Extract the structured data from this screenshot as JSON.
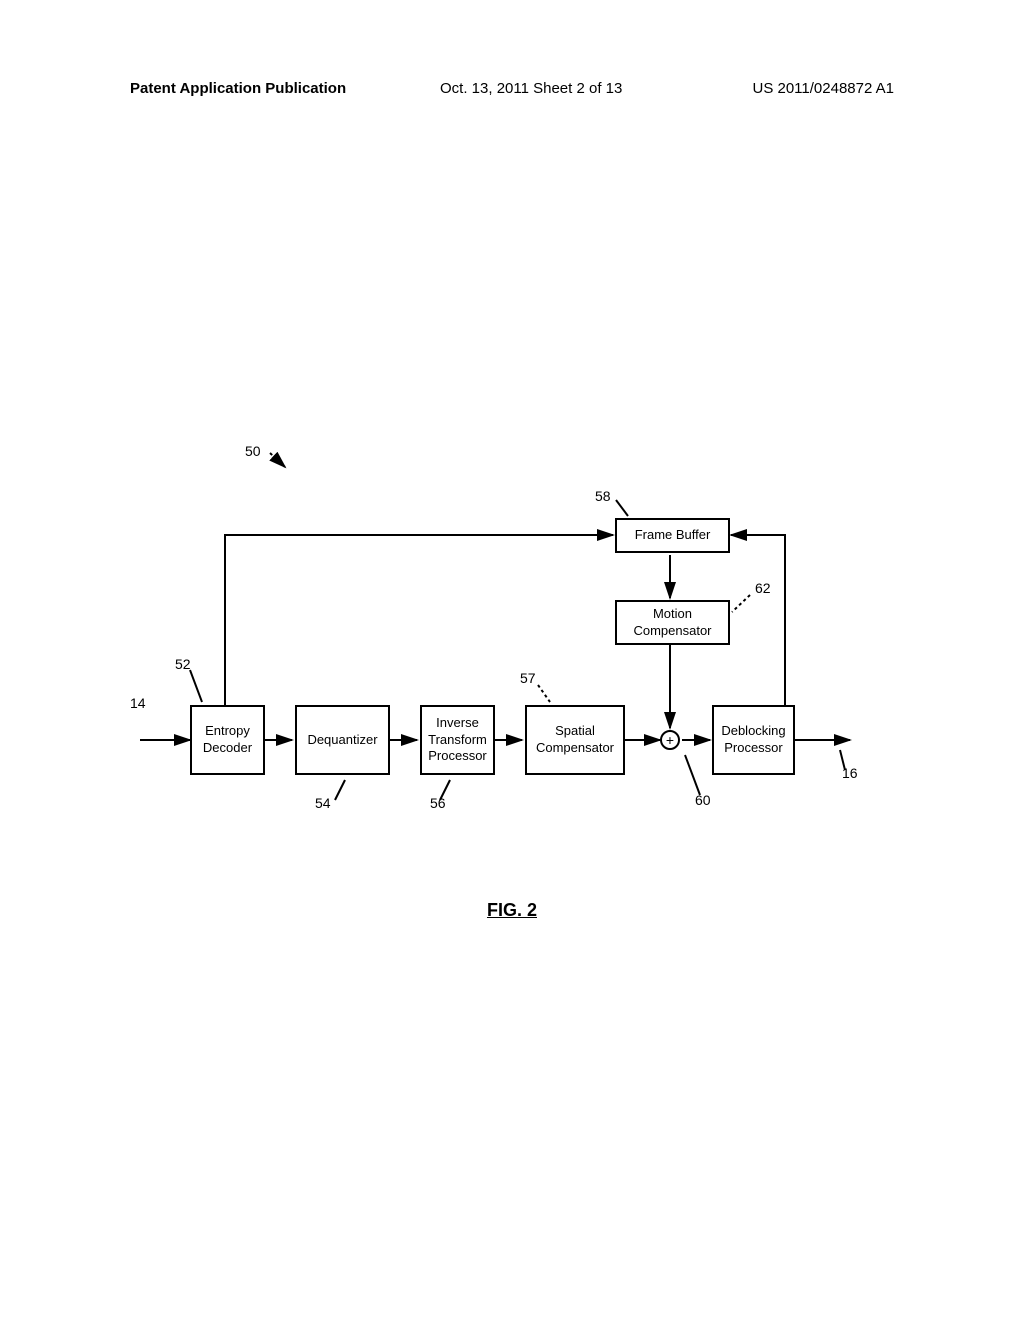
{
  "header": {
    "left": "Patent Application Publication",
    "center": "Oct. 13, 2011  Sheet 2 of 13",
    "right": "US 2011/0248872 A1"
  },
  "refs": {
    "r50": "50",
    "r58": "58",
    "r62": "62",
    "r52": "52",
    "r14": "14",
    "r57": "57",
    "r54": "54",
    "r56": "56",
    "r60": "60",
    "r16": "16"
  },
  "blocks": {
    "entropy_decoder": "Entropy\nDecoder",
    "dequantizer": "Dequantizer",
    "inverse_transform": "Inverse\nTransform\nProcessor",
    "spatial_compensator": "Spatial\nCompensator",
    "frame_buffer": "Frame Buffer",
    "motion_compensator": "Motion\nCompensator",
    "deblocking_processor": "Deblocking\nProcessor"
  },
  "figure_label": "FIG. 2",
  "chart_data": {
    "type": "diagram",
    "title": "FIG. 2",
    "description": "Block diagram of video decoder system 50",
    "nodes": [
      {
        "id": 52,
        "label": "Entropy Decoder"
      },
      {
        "id": 54,
        "label": "Dequantizer"
      },
      {
        "id": 56,
        "label": "Inverse Transform Processor"
      },
      {
        "id": 57,
        "label": "Spatial Compensator"
      },
      {
        "id": 58,
        "label": "Frame Buffer"
      },
      {
        "id": 60,
        "label": "Adder"
      },
      {
        "id": 62,
        "label": "Motion Compensator"
      },
      {
        "id": "deblocking",
        "label": "Deblocking Processor"
      }
    ],
    "edges": [
      {
        "from": 14,
        "to": 52
      },
      {
        "from": 52,
        "to": 54
      },
      {
        "from": 54,
        "to": 56
      },
      {
        "from": 56,
        "to": 57
      },
      {
        "from": 57,
        "to": 60
      },
      {
        "from": 60,
        "to": "deblocking"
      },
      {
        "from": "deblocking",
        "to": 16
      },
      {
        "from": 52,
        "to": 58
      },
      {
        "from": 58,
        "to": 62
      },
      {
        "from": 62,
        "to": 60
      },
      {
        "from": "deblocking",
        "to": 58
      }
    ]
  }
}
